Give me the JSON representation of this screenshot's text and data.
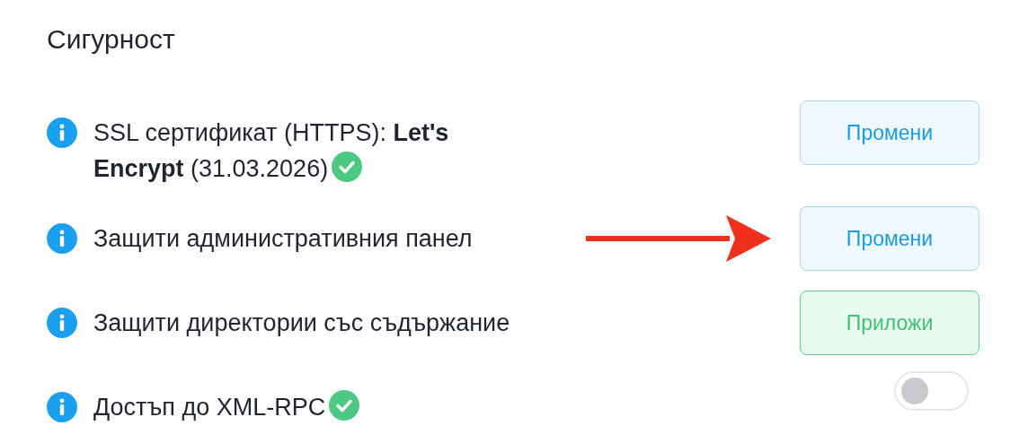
{
  "heading": "Сигурност",
  "settings": [
    {
      "kind": "button",
      "label": "SSL сертификат (HTTPS): **Let's Encrypt** (31.03.2026)",
      "verified": true,
      "pointer": false,
      "action": {
        "label": "Промени",
        "confirm": false
      }
    },
    {
      "kind": "button",
      "label": "Защити административния панел",
      "verified": false,
      "pointer": true,
      "action": {
        "label": "Промени",
        "confirm": false
      }
    },
    {
      "kind": "button",
      "label": "Защити директории със съдържание",
      "verified": false,
      "pointer": false,
      "action": {
        "label": "Приложи",
        "confirm": true
      }
    },
    {
      "kind": "toggle",
      "label": "Достъп до XML-RPC",
      "verified": true,
      "pointer": false,
      "on": false
    }
  ]
}
